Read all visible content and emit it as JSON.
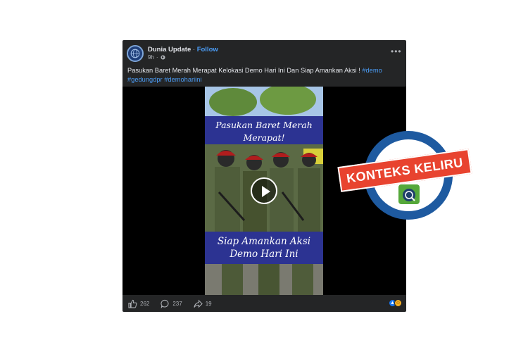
{
  "post": {
    "page_name": "Dunia Update",
    "separator": "·",
    "follow_label": "Follow",
    "time": "9h",
    "dot": "·",
    "caption_text": "Pasukan Baret Merah Merapat Kelokasi Demo Hari Ini Dan Siap Amankan Aksi ! ",
    "hashtags": [
      "#demo",
      "#gedungdpr",
      "#demohariini"
    ],
    "more_label": "•••"
  },
  "video": {
    "banner_top": [
      "Pasukan Baret Merah",
      "Merapat!"
    ],
    "banner_bottom": [
      "Siap Amankan Aksi",
      "Demo Hari Ini"
    ]
  },
  "actions": {
    "likes": "262",
    "comments": "237",
    "shares": "19"
  },
  "stamp": {
    "label": "KONTEKS KELIRU"
  },
  "colors": {
    "post_bg": "#242526",
    "link": "#4b9cf5",
    "banner": "#2c3392",
    "stamp_red": "#e8432f",
    "stamp_blue": "#1e5aa0"
  }
}
